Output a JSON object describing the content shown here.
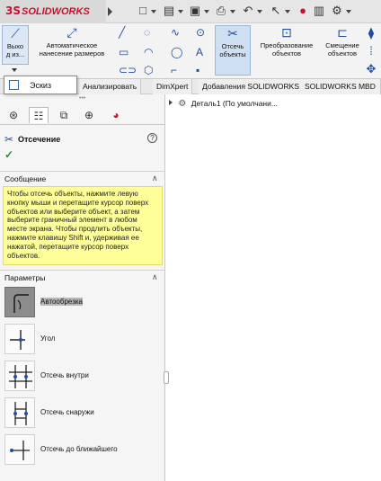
{
  "app": {
    "logo_ds": "3S",
    "logo_name": "SOLIDWORKS"
  },
  "ribbon": {
    "exit_sketch": "Выхо\nд из...",
    "auto_dimension": "Автоматическое нанесение размеров",
    "trim": "Отсечь объекты",
    "convert": "Преобразование объектов",
    "offset": "Смещение объектов"
  },
  "sketch_menu": {
    "label": "Эскиз"
  },
  "tabs": [
    "Анализировать",
    "DimXpert",
    "Добавления SOLIDWORKS",
    "SOLIDWORKS MBD"
  ],
  "panel": {
    "title": "Отсечение",
    "message_header": "Сообщение",
    "message": "Чтобы отсечь объекты, нажмите левую кнопку мыши и перетащите курсор поверх объектов или выберите объект, а затем выберите граничный элемент в любом месте экрана. Чтобы продлить объекты, нажмите клавишу Shift и, удерживая ее нажатой, перетащите курсор поверх объектов.",
    "params_header": "Параметры",
    "options": [
      {
        "label": "Автообрезка",
        "selected": true
      },
      {
        "label": "Угол",
        "selected": false
      },
      {
        "label": "Отсечь внутри",
        "selected": false
      },
      {
        "label": "Отсечь снаружи",
        "selected": false
      },
      {
        "label": "Отсечь до ближайшего",
        "selected": false
      }
    ]
  },
  "tree": {
    "root": "Деталь1  (По умолчани..."
  },
  "colors": {
    "brand": "#c8102e",
    "accent": "#1f4e9c",
    "message_bg": "#ffff99"
  }
}
